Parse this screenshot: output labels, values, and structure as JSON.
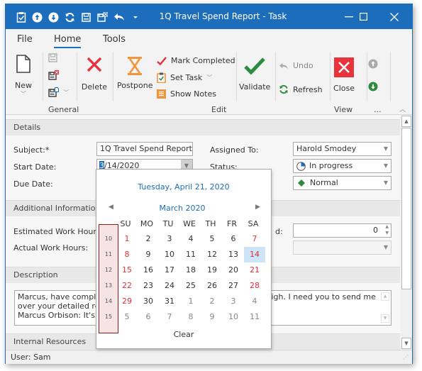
{
  "window": {
    "title": "1Q Travel Spend Report - Task",
    "controls": {
      "minimize": "—",
      "maximize": "☐",
      "close": "✕"
    },
    "qat_icons": [
      "clipboard-check-icon",
      "arrow-up-circle-icon",
      "arrow-down-circle-icon",
      "refresh-icon",
      "save-icon",
      "save-close-icon",
      "undo-icon",
      "qat-customize-icon"
    ]
  },
  "tabs": [
    {
      "label": "File",
      "active": false
    },
    {
      "label": "Home",
      "active": true
    },
    {
      "label": "Tools",
      "active": false
    }
  ],
  "ribbon": {
    "groups": {
      "general": "General",
      "edit": "Edit",
      "view": "View",
      "more": "..."
    },
    "buttons": {
      "new": "New",
      "delete": "Delete",
      "postpone": "Postpone",
      "mark_completed": "Mark Completed",
      "set_task": "Set Task",
      "show_notes": "Show Notes",
      "validate": "Validate",
      "undo": "Undo",
      "refresh": "Refresh",
      "close": "Close"
    },
    "colors": {
      "delete": "#e8323c",
      "postpone": "#f2943a",
      "validate": "#2e8b3e",
      "close_bg": "#e8323c",
      "accent": "#1c6ebc"
    }
  },
  "details": {
    "header": "Details",
    "subject_label": "Subject:*",
    "subject_value": "1Q Travel Spend Report",
    "start_date_label": "Start Date:",
    "start_date_value": "3/14/2020",
    "start_date_selected_part": "3",
    "start_date_rest": "/14/2020",
    "due_date_label": "Due Date:",
    "assigned_to_label": "Assigned To:",
    "assigned_to_value": "Harold Smodey",
    "status_label": "Status:",
    "status_value": "In progress",
    "priority_value": "Normal"
  },
  "additional": {
    "header": "Additional Information",
    "estimated_label": "Estimated Work Hours:",
    "actual_label": "Actual Work Hours:",
    "right_label_fragment": "d:",
    "right_spin_value": "0"
  },
  "description": {
    "header": "Description",
    "lines": [
      "Marcus, have complaints about your travel expenses being too high. I need you to send me",
      "over your detailed report",
      "Marcus Orbison: It's going"
    ],
    "visible_left": [
      "Marcus, have complaint",
      "over your detailed repo",
      "Marcus Orbison: It's go"
    ],
    "visible_right_line1": "gh. I need you to send me"
  },
  "internal_resources": {
    "header": "Internal Resources"
  },
  "statusbar": {
    "user": "User: Sam"
  },
  "calendar": {
    "today_text": "Tuesday, April 21, 2020",
    "month_title": "March 2020",
    "days_of_week": [
      "SU",
      "MO",
      "TU",
      "WE",
      "TH",
      "FR",
      "SA"
    ],
    "week_numbers": [
      "10",
      "11",
      "12",
      "13",
      "14",
      "15"
    ],
    "weeks": [
      [
        "1",
        "2",
        "3",
        "4",
        "5",
        "6",
        "7"
      ],
      [
        "8",
        "9",
        "10",
        "11",
        "12",
        "13",
        "14"
      ],
      [
        "15",
        "16",
        "17",
        "18",
        "19",
        "20",
        "21"
      ],
      [
        "22",
        "23",
        "24",
        "25",
        "26",
        "27",
        "28"
      ],
      [
        "29",
        "30",
        "31",
        "1",
        "2",
        "3",
        "4"
      ],
      [
        "5",
        "6",
        "7",
        "8",
        "9",
        "10",
        "11"
      ]
    ],
    "selected": {
      "week": 1,
      "day": 6
    },
    "other_month_start": {
      "week": 4,
      "day": 3
    },
    "clear_label": "Clear",
    "colors": {
      "weekend": "#e0303a",
      "selected_bg": "#cde4f7",
      "week_col_bg": "#f6e4e4",
      "week_col_border": "#8b1c1c"
    }
  }
}
